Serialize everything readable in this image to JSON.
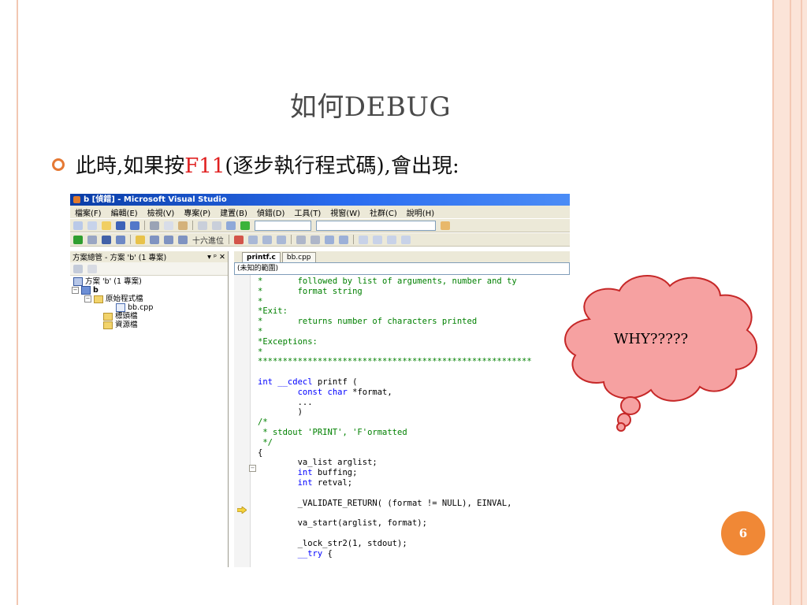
{
  "slide": {
    "title": "如何DEBUG",
    "bullet_prefix": "此時,如果按",
    "bullet_key": "F11",
    "bullet_suffix": "(逐步執行程式碼),會出現:",
    "cloud_text": "WHY?????",
    "page_number": "6"
  },
  "vs": {
    "window_title": "b [偵錯] - Microsoft Visual Studio",
    "menu": [
      "檔案(F)",
      "編輯(E)",
      "檢視(V)",
      "專案(P)",
      "建置(B)",
      "偵錯(D)",
      "工具(T)",
      "視窗(W)",
      "社群(C)",
      "說明(H)"
    ],
    "toolbar2_text": "十六進位",
    "solution_panel": {
      "header": "方案總管 - 方案 'b' (1 專案)",
      "pin": "▾ ᵖ ✕",
      "root": "方案 'b' (1 專案)",
      "project": "b",
      "folder_source": "原始程式檔",
      "file_cpp": "bb.cpp",
      "folder_headers": "標頭檔",
      "folder_resources": "資源檔"
    },
    "tabs": [
      "printf.c",
      "bb.cpp"
    ],
    "scope": "(未知的範圍)",
    "code_lines": [
      {
        "t": "*       followed by list of arguments, number and ty",
        "c": "c"
      },
      {
        "t": "*       format string",
        "c": "c"
      },
      {
        "t": "*",
        "c": "c"
      },
      {
        "t": "*Exit:",
        "c": "c"
      },
      {
        "t": "*       returns number of characters printed",
        "c": "c"
      },
      {
        "t": "*",
        "c": "c"
      },
      {
        "t": "*Exceptions:",
        "c": "c"
      },
      {
        "t": "*",
        "c": "c"
      },
      {
        "t": "*******************************************************",
        "c": "c"
      },
      {
        "t": "",
        "c": ""
      },
      {
        "t": "int __cdecl printf (",
        "c": "mix1"
      },
      {
        "t": "        const char *format,",
        "c": "mix2"
      },
      {
        "t": "        ...",
        "c": ""
      },
      {
        "t": "        )",
        "c": ""
      },
      {
        "t": "/*",
        "c": "c"
      },
      {
        "t": " * stdout 'PRINT', 'F'ormatted",
        "c": "c"
      },
      {
        "t": " */",
        "c": "c"
      },
      {
        "t": "{",
        "c": ""
      },
      {
        "t": "        va_list arglist;",
        "c": ""
      },
      {
        "t": "        int buffing;",
        "c": "mix3"
      },
      {
        "t": "        int retval;",
        "c": "mix4"
      },
      {
        "t": "",
        "c": ""
      },
      {
        "t": "        _VALIDATE_RETURN( (format != NULL), EINVAL,",
        "c": ""
      },
      {
        "t": "",
        "c": ""
      },
      {
        "t": "        va_start(arglist, format);",
        "c": ""
      },
      {
        "t": "",
        "c": ""
      },
      {
        "t": "        _lock_str2(1, stdout);",
        "c": ""
      },
      {
        "t": "        __try {",
        "c": "mix5"
      }
    ]
  }
}
